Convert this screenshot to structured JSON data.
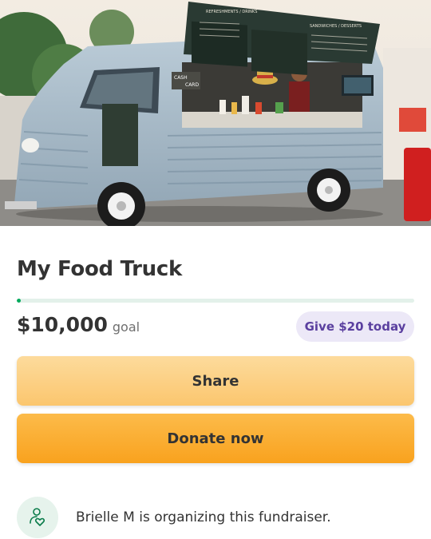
{
  "hero": {
    "truck_sign_left": "REFRESHMENTS / DRINKS",
    "truck_sign_right": "SANDWICHES / DESSERTS",
    "truck_badge_line1": "CASH",
    "truck_badge_line2": "CARD"
  },
  "campaign": {
    "title": "My Food Truck",
    "amount": "$10,000",
    "goal_label": "goal",
    "progress_fraction": 0.01
  },
  "actions": {
    "give_pill_label": "Give $20 today",
    "share_label": "Share",
    "donate_label": "Donate now"
  },
  "organizer": {
    "text": "Brielle M is organizing this fundraiser."
  },
  "colors": {
    "progress_fill": "#02a95c",
    "pill_text": "#5a3f9f",
    "share_gradient_top": "#fddb9c",
    "donate_gradient_top": "#fcbb4a"
  },
  "icons": {
    "organizer": "person-heart-icon"
  }
}
